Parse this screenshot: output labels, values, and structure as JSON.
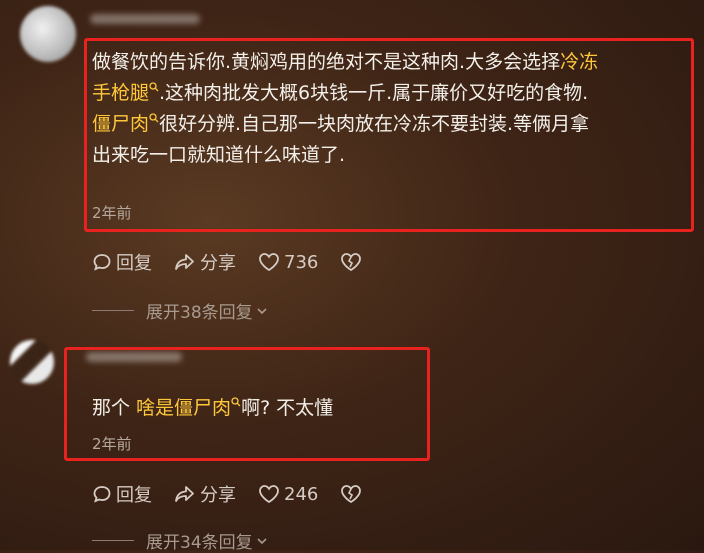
{
  "comments": [
    {
      "lines": [
        [
          {
            "t": "做餐饮的告诉你.黄焖鸡用的绝对不是这种肉.大多会选择"
          },
          {
            "t": "冷冻",
            "kw": true,
            "mag": false
          }
        ],
        [
          {
            "t": "手枪腿",
            "kw": true,
            "mag": true
          },
          {
            "t": ".这种肉批发大概6块钱一斤.属于廉价又好吃的食物."
          }
        ],
        [
          {
            "t": "僵尸肉",
            "kw": true,
            "mag": true
          },
          {
            "t": "很好分辨.自己那一块肉放在冷冻不要封装.等俩月拿"
          }
        ],
        [
          {
            "t": "出来吃一口就知道什么味道了."
          }
        ]
      ],
      "time": "2年前",
      "reply_label": "回复",
      "share_label": "分享",
      "likes": "736",
      "expand_label": "展开38条回复"
    },
    {
      "lines": [
        [
          {
            "t": "那个 "
          },
          {
            "t": "啥是僵尸肉",
            "kw": true,
            "mag": true
          },
          {
            "t": "啊?  不太懂"
          }
        ]
      ],
      "time": "2年前",
      "reply_label": "回复",
      "share_label": "分享",
      "likes": "246",
      "expand_label": "展开34条回复"
    }
  ],
  "colors": {
    "keyword": "#ffc83a",
    "highlight_box": "#e8231f"
  },
  "icons": [
    "reply-icon",
    "share-icon",
    "like-heart-icon",
    "dislike-broken-heart-icon",
    "chevron-down-icon",
    "search-keyword-icon"
  ]
}
